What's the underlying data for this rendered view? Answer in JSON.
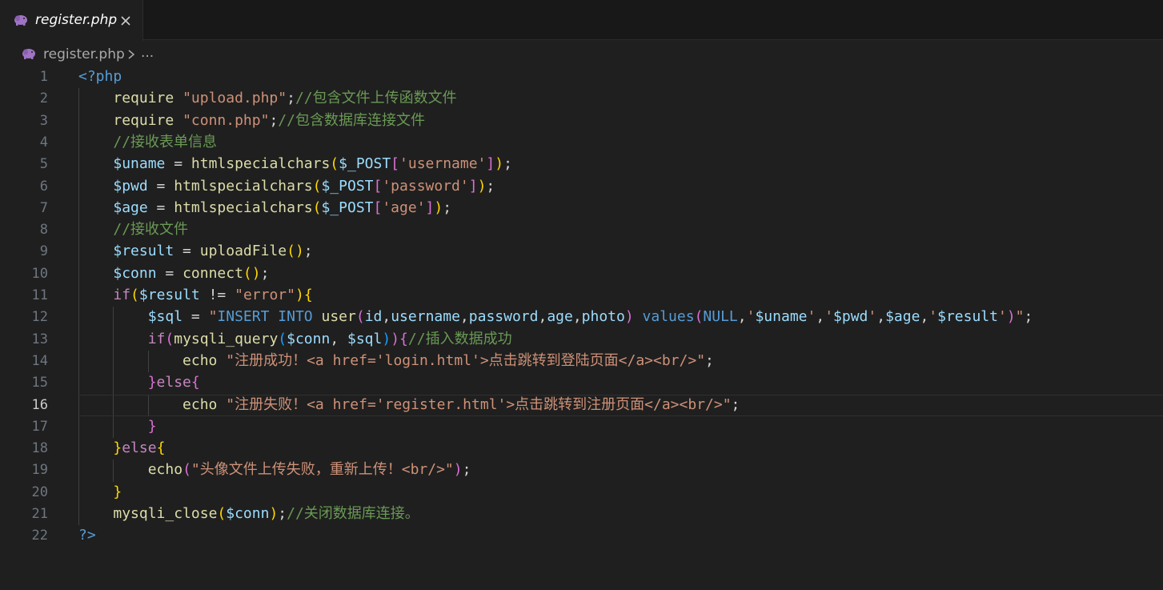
{
  "tab": {
    "title": "register.php",
    "icon": "php-elephant-icon",
    "close_icon": "close-icon"
  },
  "breadcrumb": {
    "file": "register.php",
    "separator_icon": "chevron-right-icon",
    "more": "..."
  },
  "editor": {
    "active_line": 16,
    "lines": [
      {
        "n": "1",
        "tokens": [
          [
            "t-tag",
            "<?php"
          ]
        ]
      },
      {
        "n": "2",
        "tokens": [
          [
            "t-op",
            "    "
          ],
          [
            "t-kw",
            "require"
          ],
          [
            "t-op",
            " "
          ],
          [
            "t-str",
            "\"upload.php\""
          ],
          [
            "t-op",
            ";"
          ],
          [
            "t-com",
            "//包含文件上传函数文件"
          ]
        ]
      },
      {
        "n": "3",
        "tokens": [
          [
            "t-op",
            "    "
          ],
          [
            "t-kw",
            "require"
          ],
          [
            "t-op",
            " "
          ],
          [
            "t-str",
            "\"conn.php\""
          ],
          [
            "t-op",
            ";"
          ],
          [
            "t-com",
            "//包含数据库连接文件"
          ]
        ]
      },
      {
        "n": "4",
        "tokens": [
          [
            "t-op",
            "    "
          ],
          [
            "t-com",
            "//接收表单信息"
          ]
        ]
      },
      {
        "n": "5",
        "tokens": [
          [
            "t-op",
            "    "
          ],
          [
            "t-var",
            "$uname"
          ],
          [
            "t-op",
            " = "
          ],
          [
            "t-fn",
            "htmlspecialchars"
          ],
          [
            "t-b1",
            "("
          ],
          [
            "t-var",
            "$_POST"
          ],
          [
            "t-b2",
            "["
          ],
          [
            "t-str",
            "'username'"
          ],
          [
            "t-b2",
            "]"
          ],
          [
            "t-b1",
            ")"
          ],
          [
            "t-op",
            ";"
          ]
        ]
      },
      {
        "n": "6",
        "tokens": [
          [
            "t-op",
            "    "
          ],
          [
            "t-var",
            "$pwd"
          ],
          [
            "t-op",
            " = "
          ],
          [
            "t-fn",
            "htmlspecialchars"
          ],
          [
            "t-b1",
            "("
          ],
          [
            "t-var",
            "$_POST"
          ],
          [
            "t-b2",
            "["
          ],
          [
            "t-str",
            "'password'"
          ],
          [
            "t-b2",
            "]"
          ],
          [
            "t-b1",
            ")"
          ],
          [
            "t-op",
            ";"
          ]
        ]
      },
      {
        "n": "7",
        "tokens": [
          [
            "t-op",
            "    "
          ],
          [
            "t-var",
            "$age"
          ],
          [
            "t-op",
            " = "
          ],
          [
            "t-fn",
            "htmlspecialchars"
          ],
          [
            "t-b1",
            "("
          ],
          [
            "t-var",
            "$_POST"
          ],
          [
            "t-b2",
            "["
          ],
          [
            "t-str",
            "'age'"
          ],
          [
            "t-b2",
            "]"
          ],
          [
            "t-b1",
            ")"
          ],
          [
            "t-op",
            ";"
          ]
        ]
      },
      {
        "n": "8",
        "tokens": [
          [
            "t-op",
            "    "
          ],
          [
            "t-com",
            "//接收文件"
          ]
        ]
      },
      {
        "n": "9",
        "tokens": [
          [
            "t-op",
            "    "
          ],
          [
            "t-var",
            "$result"
          ],
          [
            "t-op",
            " = "
          ],
          [
            "t-fn",
            "uploadFile"
          ],
          [
            "t-b1",
            "()"
          ],
          [
            "t-op",
            ";"
          ]
        ]
      },
      {
        "n": "10",
        "tokens": [
          [
            "t-op",
            "    "
          ],
          [
            "t-var",
            "$conn"
          ],
          [
            "t-op",
            " = "
          ],
          [
            "t-fn",
            "connect"
          ],
          [
            "t-b1",
            "()"
          ],
          [
            "t-op",
            ";"
          ]
        ]
      },
      {
        "n": "11",
        "tokens": [
          [
            "t-op",
            "    "
          ],
          [
            "t-ctrl",
            "if"
          ],
          [
            "t-b1",
            "("
          ],
          [
            "t-var",
            "$result"
          ],
          [
            "t-op",
            " != "
          ],
          [
            "t-str",
            "\"error\""
          ],
          [
            "t-b1",
            ")"
          ],
          [
            "t-b1",
            "{"
          ]
        ]
      },
      {
        "n": "12",
        "tokens": [
          [
            "t-op",
            "        "
          ],
          [
            "t-var",
            "$sql"
          ],
          [
            "t-op",
            " = "
          ],
          [
            "t-str",
            "\""
          ],
          [
            "t-sqlkw",
            "INSERT INTO"
          ],
          [
            "t-str",
            " "
          ],
          [
            "t-fn",
            "user"
          ],
          [
            "t-b2",
            "("
          ],
          [
            "t-var",
            "id"
          ],
          [
            "t-op",
            ","
          ],
          [
            "t-var",
            "username"
          ],
          [
            "t-op",
            ","
          ],
          [
            "t-var",
            "password"
          ],
          [
            "t-op",
            ","
          ],
          [
            "t-var",
            "age"
          ],
          [
            "t-op",
            ","
          ],
          [
            "t-var",
            "photo"
          ],
          [
            "t-b2",
            ")"
          ],
          [
            "t-str",
            " "
          ],
          [
            "t-sqlkw",
            "values"
          ],
          [
            "t-b2",
            "("
          ],
          [
            "t-sqlkw",
            "NULL"
          ],
          [
            "t-op",
            ","
          ],
          [
            "t-str",
            "'"
          ],
          [
            "t-var",
            "$uname"
          ],
          [
            "t-str",
            "'"
          ],
          [
            "t-op",
            ","
          ],
          [
            "t-str",
            "'"
          ],
          [
            "t-var",
            "$pwd"
          ],
          [
            "t-str",
            "'"
          ],
          [
            "t-op",
            ","
          ],
          [
            "t-var",
            "$age"
          ],
          [
            "t-op",
            ","
          ],
          [
            "t-str",
            "'"
          ],
          [
            "t-var",
            "$result"
          ],
          [
            "t-str",
            "'"
          ],
          [
            "t-b2",
            ")"
          ],
          [
            "t-str",
            "\""
          ],
          [
            "t-op",
            ";"
          ]
        ]
      },
      {
        "n": "13",
        "tokens": [
          [
            "t-op",
            "        "
          ],
          [
            "t-ctrl",
            "if"
          ],
          [
            "t-b2",
            "("
          ],
          [
            "t-fn",
            "mysqli_query"
          ],
          [
            "t-b3",
            "("
          ],
          [
            "t-var",
            "$conn"
          ],
          [
            "t-op",
            ", "
          ],
          [
            "t-var",
            "$sql"
          ],
          [
            "t-b3",
            ")"
          ],
          [
            "t-b2",
            ")"
          ],
          [
            "t-b2",
            "{"
          ],
          [
            "t-com",
            "//插入数据成功"
          ]
        ]
      },
      {
        "n": "14",
        "tokens": [
          [
            "t-op",
            "            "
          ],
          [
            "t-kw",
            "echo"
          ],
          [
            "t-op",
            " "
          ],
          [
            "t-str",
            "\"注册成功！<a href='login.html'>点击跳转到登陆页面</a><br/>\""
          ],
          [
            "t-op",
            ";"
          ]
        ]
      },
      {
        "n": "15",
        "tokens": [
          [
            "t-op",
            "        "
          ],
          [
            "t-b2",
            "}"
          ],
          [
            "t-ctrl",
            "else"
          ],
          [
            "t-b2",
            "{"
          ]
        ]
      },
      {
        "n": "16",
        "tokens": [
          [
            "t-op",
            "            "
          ],
          [
            "t-kw",
            "echo"
          ],
          [
            "t-op",
            " "
          ],
          [
            "t-str",
            "\"注册失败！<a href='register.html'>点击跳转到注册页面</a><br/>\""
          ],
          [
            "t-op",
            ";"
          ]
        ]
      },
      {
        "n": "17",
        "tokens": [
          [
            "t-op",
            "        "
          ],
          [
            "t-b2",
            "}"
          ]
        ]
      },
      {
        "n": "18",
        "tokens": [
          [
            "t-op",
            "    "
          ],
          [
            "t-b1",
            "}"
          ],
          [
            "t-ctrl",
            "else"
          ],
          [
            "t-b1",
            "{"
          ]
        ]
      },
      {
        "n": "19",
        "tokens": [
          [
            "t-op",
            "        "
          ],
          [
            "t-kw",
            "echo"
          ],
          [
            "t-b2",
            "("
          ],
          [
            "t-str",
            "\"头像文件上传失败，重新上传！<br/>\""
          ],
          [
            "t-b2",
            ")"
          ],
          [
            "t-op",
            ";"
          ]
        ]
      },
      {
        "n": "20",
        "tokens": [
          [
            "t-op",
            "    "
          ],
          [
            "t-b1",
            "}"
          ]
        ]
      },
      {
        "n": "21",
        "tokens": [
          [
            "t-op",
            "    "
          ],
          [
            "t-fn",
            "mysqli_close"
          ],
          [
            "t-b1",
            "("
          ],
          [
            "t-var",
            "$conn"
          ],
          [
            "t-b1",
            ")"
          ],
          [
            "t-op",
            ";"
          ],
          [
            "t-com",
            "//关闭数据库连接。"
          ]
        ]
      },
      {
        "n": "22",
        "tokens": [
          [
            "t-tag",
            "?>"
          ]
        ]
      }
    ]
  }
}
